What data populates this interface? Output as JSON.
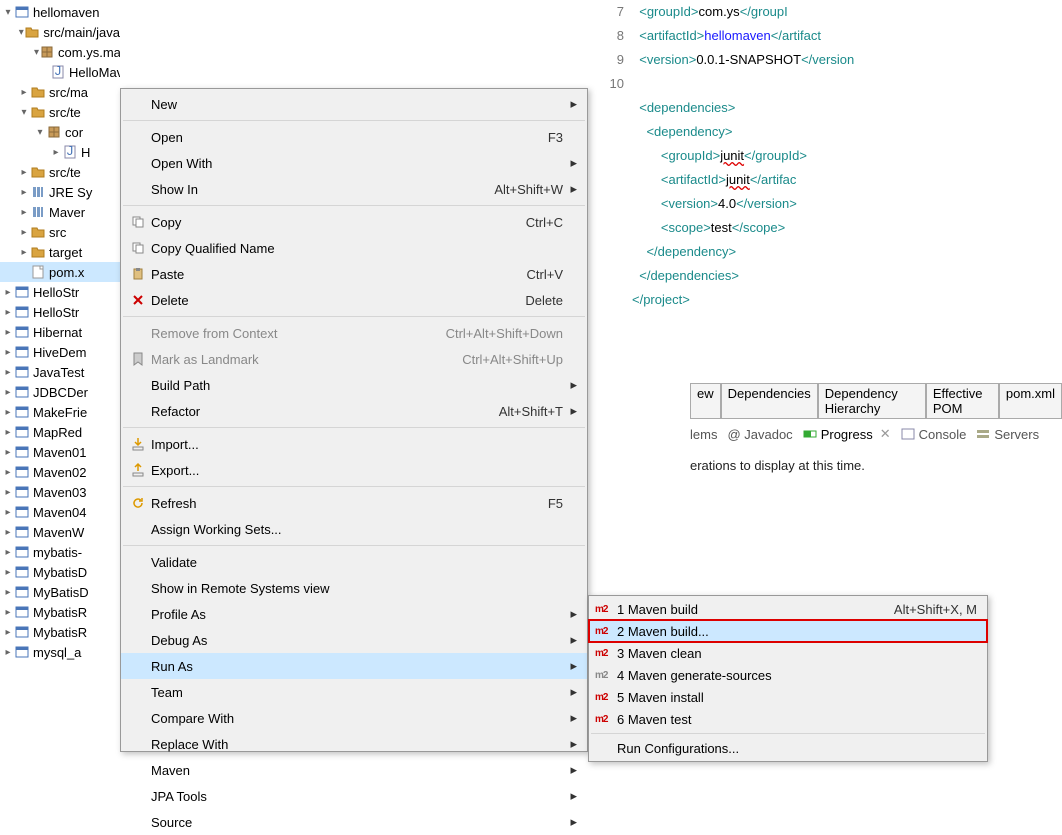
{
  "tree": {
    "items": [
      {
        "chev": "v",
        "icon": "project",
        "label": "hellomaven",
        "indent": 0
      },
      {
        "chev": "v",
        "icon": "folder-src",
        "label": "src/main/java",
        "indent": 1
      },
      {
        "chev": "v",
        "icon": "package",
        "label": "com.ys.maven",
        "indent": 2
      },
      {
        "chev": "",
        "icon": "java",
        "label": "HelloMaven.java",
        "indent": 3
      },
      {
        "chev": ">",
        "icon": "folder-src",
        "label": "src/ma",
        "indent": 1
      },
      {
        "chev": "v",
        "icon": "folder-src",
        "label": "src/te",
        "indent": 1
      },
      {
        "chev": "v",
        "icon": "package",
        "label": "cor",
        "indent": 2
      },
      {
        "chev": ">",
        "icon": "java",
        "label": "H",
        "indent": 3
      },
      {
        "chev": ">",
        "icon": "folder-src",
        "label": "src/te",
        "indent": 1
      },
      {
        "chev": ">",
        "icon": "library",
        "label": "JRE Sy",
        "indent": 1
      },
      {
        "chev": ">",
        "icon": "library",
        "label": "Maver",
        "indent": 1
      },
      {
        "chev": ">",
        "icon": "folder",
        "label": "src",
        "indent": 1
      },
      {
        "chev": ">",
        "icon": "folder",
        "label": "target",
        "indent": 1
      },
      {
        "chev": "",
        "icon": "file",
        "label": "pom.x",
        "indent": 1,
        "selected": true
      },
      {
        "chev": ">",
        "icon": "project",
        "label": "HelloStr",
        "indent": 0
      },
      {
        "chev": ">",
        "icon": "project",
        "label": "HelloStr",
        "indent": 0
      },
      {
        "chev": ">",
        "icon": "project",
        "label": "Hibernat",
        "indent": 0
      },
      {
        "chev": ">",
        "icon": "project",
        "label": "HiveDem",
        "indent": 0
      },
      {
        "chev": ">",
        "icon": "project",
        "label": "JavaTest",
        "indent": 0
      },
      {
        "chev": ">",
        "icon": "project",
        "label": "JDBCDer",
        "indent": 0
      },
      {
        "chev": ">",
        "icon": "project",
        "label": "MakeFrie",
        "indent": 0
      },
      {
        "chev": ">",
        "icon": "project",
        "label": "MapRed",
        "indent": 0
      },
      {
        "chev": ">",
        "icon": "project",
        "label": "Maven01",
        "indent": 0
      },
      {
        "chev": ">",
        "icon": "project",
        "label": "Maven02",
        "indent": 0
      },
      {
        "chev": ">",
        "icon": "project",
        "label": "Maven03",
        "indent": 0
      },
      {
        "chev": ">",
        "icon": "project",
        "label": "Maven04",
        "indent": 0
      },
      {
        "chev": ">",
        "icon": "project",
        "label": "MavenW",
        "indent": 0
      },
      {
        "chev": ">",
        "icon": "project",
        "label": "mybatis-",
        "indent": 0
      },
      {
        "chev": ">",
        "icon": "project",
        "label": "MybatisD",
        "indent": 0
      },
      {
        "chev": ">",
        "icon": "project",
        "label": "MyBatisD",
        "indent": 0
      },
      {
        "chev": ">",
        "icon": "project",
        "label": "MybatisR",
        "indent": 0
      },
      {
        "chev": ">",
        "icon": "project",
        "label": "MybatisR",
        "indent": 0
      },
      {
        "chev": ">",
        "icon": "project",
        "label": "mysql_a",
        "indent": 0
      }
    ]
  },
  "code": {
    "lines": [
      {
        "n": "7",
        "html": "  <span class='tag'>&lt;groupId&gt;</span><span class='txt'>com.ys</span><span class='tag'>&lt;/groupI</span>"
      },
      {
        "n": "8",
        "html": "  <span class='tag'>&lt;artifactId&gt;</span><span class='blue'>hellomaven</span><span class='tag'>&lt;/artifact</span>"
      },
      {
        "n": "9",
        "html": "  <span class='tag'>&lt;version&gt;</span><span class='txt'>0.0.1-SNAPSHOT</span><span class='tag'>&lt;/version</span>"
      },
      {
        "n": "10",
        "html": ""
      },
      {
        "n": "",
        "html": "  <span class='tag'>&lt;dependencies&gt;</span>"
      },
      {
        "n": "",
        "html": "    <span class='tag'>&lt;dependency&gt;</span>"
      },
      {
        "n": "",
        "html": "        <span class='tag'>&lt;groupId&gt;</span><span class='wavy'>junit</span><span class='tag'>&lt;/groupId&gt;</span>"
      },
      {
        "n": "",
        "html": "        <span class='tag'>&lt;artifactId&gt;</span><span class='wavy'>junit</span><span class='tag'>&lt;/artifac</span>"
      },
      {
        "n": "",
        "html": "        <span class='tag'>&lt;version&gt;</span><span class='txt'>4.0</span><span class='tag'>&lt;/version&gt;</span>"
      },
      {
        "n": "",
        "html": "        <span class='tag'>&lt;scope&gt;</span><span class='txt'>test</span><span class='tag'>&lt;/scope&gt;</span>"
      },
      {
        "n": "",
        "html": "    <span class='tag'>&lt;/dependency&gt;</span>"
      },
      {
        "n": "",
        "html": "  <span class='tag'>&lt;/dependencies&gt;</span>"
      },
      {
        "n": "",
        "html": "",
        "hl": true
      },
      {
        "n": "",
        "html": "<span class='tag'>&lt;/project&gt;</span>"
      }
    ]
  },
  "editor_tabs": [
    "ew",
    "Dependencies",
    "Dependency Hierarchy",
    "Effective POM",
    "pom.xml"
  ],
  "views": {
    "problems": "lems",
    "javadoc": "@ Javadoc",
    "progress": "Progress",
    "console": "Console",
    "servers": "Servers"
  },
  "progress_text": "erations to display at this time.",
  "ctx": [
    {
      "icon": "",
      "label": "New",
      "shortcut": "",
      "sub": true
    },
    {
      "sep": true
    },
    {
      "icon": "",
      "label": "Open",
      "shortcut": "F3"
    },
    {
      "icon": "",
      "label": "Open With",
      "shortcut": "",
      "sub": true
    },
    {
      "icon": "",
      "label": "Show In",
      "shortcut": "Alt+Shift+W",
      "sub": true
    },
    {
      "sep": true
    },
    {
      "icon": "copy",
      "label": "Copy",
      "shortcut": "Ctrl+C"
    },
    {
      "icon": "copy",
      "label": "Copy Qualified Name",
      "shortcut": ""
    },
    {
      "icon": "paste",
      "label": "Paste",
      "shortcut": "Ctrl+V"
    },
    {
      "icon": "delete",
      "label": "Delete",
      "shortcut": "Delete"
    },
    {
      "sep": true
    },
    {
      "icon": "",
      "label": "Remove from Context",
      "shortcut": "Ctrl+Alt+Shift+Down",
      "disabled": true
    },
    {
      "icon": "bookmark",
      "label": "Mark as Landmark",
      "shortcut": "Ctrl+Alt+Shift+Up",
      "disabled": true
    },
    {
      "icon": "",
      "label": "Build Path",
      "shortcut": "",
      "sub": true
    },
    {
      "icon": "",
      "label": "Refactor",
      "shortcut": "Alt+Shift+T",
      "sub": true
    },
    {
      "sep": true
    },
    {
      "icon": "import",
      "label": "Import...",
      "shortcut": ""
    },
    {
      "icon": "export",
      "label": "Export...",
      "shortcut": ""
    },
    {
      "sep": true
    },
    {
      "icon": "refresh",
      "label": "Refresh",
      "shortcut": "F5"
    },
    {
      "icon": "",
      "label": "Assign Working Sets...",
      "shortcut": ""
    },
    {
      "sep": true
    },
    {
      "icon": "",
      "label": "Validate",
      "shortcut": ""
    },
    {
      "icon": "",
      "label": "Show in Remote Systems view",
      "shortcut": ""
    },
    {
      "icon": "",
      "label": "Profile As",
      "shortcut": "",
      "sub": true
    },
    {
      "icon": "",
      "label": "Debug As",
      "shortcut": "",
      "sub": true
    },
    {
      "icon": "",
      "label": "Run As",
      "shortcut": "",
      "sub": true,
      "selected": true
    },
    {
      "icon": "",
      "label": "Team",
      "shortcut": "",
      "sub": true
    },
    {
      "icon": "",
      "label": "Compare With",
      "shortcut": "",
      "sub": true
    },
    {
      "icon": "",
      "label": "Replace With",
      "shortcut": "",
      "sub": true
    },
    {
      "icon": "",
      "label": "Maven",
      "shortcut": "",
      "sub": true
    },
    {
      "icon": "",
      "label": "JPA Tools",
      "shortcut": "",
      "sub": true
    },
    {
      "icon": "",
      "label": "Source",
      "shortcut": "",
      "sub": true
    }
  ],
  "submenu": [
    {
      "m2": "red",
      "label": "1 Maven build",
      "shortcut": "Alt+Shift+X, M"
    },
    {
      "m2": "red",
      "label": "2 Maven build...",
      "selected": true,
      "boxed": true
    },
    {
      "m2": "red",
      "label": "3 Maven clean"
    },
    {
      "m2": "gray",
      "label": "4 Maven generate-sources"
    },
    {
      "m2": "red",
      "label": "5 Maven install"
    },
    {
      "m2": "red",
      "label": "6 Maven test"
    },
    {
      "sep": true
    },
    {
      "m2": "",
      "label": "Run Configurations..."
    }
  ]
}
